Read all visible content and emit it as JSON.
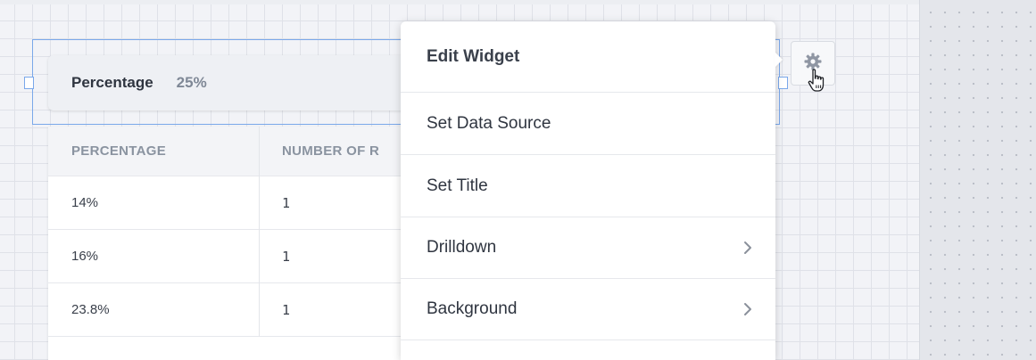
{
  "widget": {
    "title_label": "Percentage",
    "title_value": "25%"
  },
  "table": {
    "columns": [
      "PERCENTAGE",
      "NUMBER OF R"
    ],
    "rows": [
      [
        "14%",
        "1"
      ],
      [
        "16%",
        "1"
      ],
      [
        "23.8%",
        "1"
      ]
    ]
  },
  "context_menu": {
    "header": "Edit Widget",
    "items": [
      {
        "label": "Set Data Source",
        "has_submenu": false
      },
      {
        "label": "Set Title",
        "has_submenu": false
      },
      {
        "label": "Drilldown",
        "has_submenu": true
      },
      {
        "label": "Background",
        "has_submenu": true
      }
    ]
  },
  "icons": {
    "settings": "gear-icon",
    "submenu": "chevron-right-icon",
    "pointer": "hand-cursor-icon"
  },
  "colors": {
    "selection": "#7aa8ea",
    "text_primary": "#2f3540",
    "text_muted": "#8a93a0"
  }
}
